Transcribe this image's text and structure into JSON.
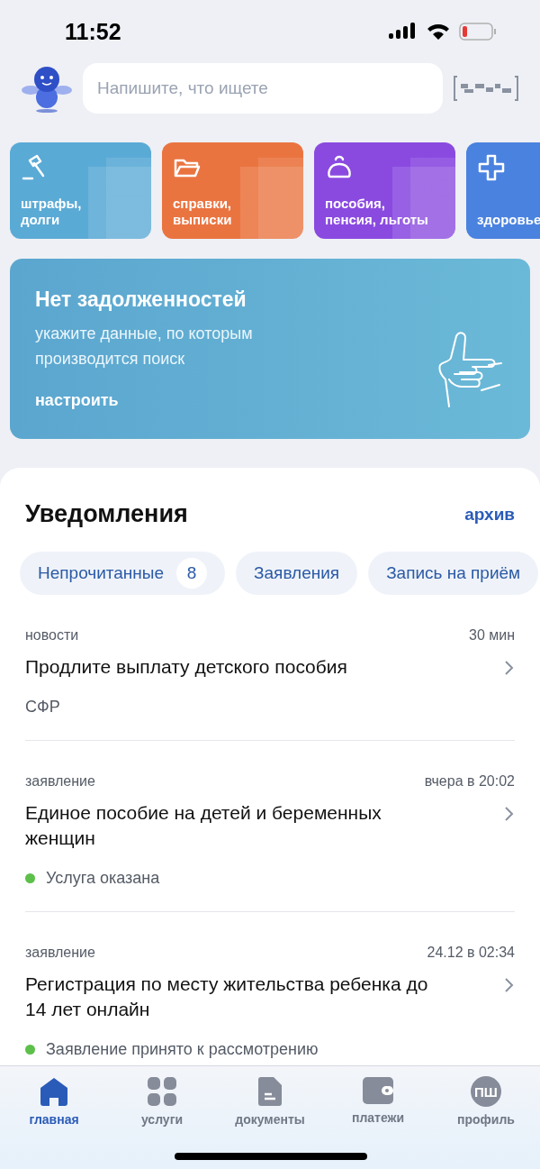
{
  "status_bar": {
    "time": "11:52"
  },
  "search": {
    "placeholder": "Напишите, что ищете"
  },
  "tiles": [
    {
      "kind": "gavel",
      "label": "штрафы,\nдолги",
      "color": "#5aaad6"
    },
    {
      "kind": "folder",
      "label": "справки,\nвыписки",
      "color": "#ea7440"
    },
    {
      "kind": "purse",
      "label": "пособия,\nпенсия, льготы",
      "color": "#8a4ae0"
    },
    {
      "kind": "cross",
      "label": "здоровье",
      "color": "#4a82e0"
    }
  ],
  "banner": {
    "title": "Нет задолженностей",
    "text": "укажите данные, по которым производится поиск",
    "action": "настроить"
  },
  "notifications": {
    "title": "Уведомления",
    "archive": "архив",
    "filters": [
      {
        "label": "Непрочитанные",
        "count": "8"
      },
      {
        "label": "Заявления"
      },
      {
        "label": "Запись на приём"
      }
    ],
    "items": [
      {
        "category": "новости",
        "time": "30 мин",
        "title": "Продлите выплату детского пособия",
        "kind": "source",
        "note": "СФР"
      },
      {
        "category": "заявление",
        "time": "вчера в 20:02",
        "title": "Единое пособие на детей и беременных женщин",
        "kind": "status",
        "note": "Услуга оказана",
        "color": "#5cc04a"
      },
      {
        "category": "заявление",
        "time": "24.12 в 02:34",
        "title": "Регистрация по месту жительства ребенка до 14 лет онлайн",
        "kind": "status",
        "note": "Заявление принято к рассмотрению",
        "color": "#5cc04a"
      }
    ]
  },
  "nav": [
    {
      "kind": "home",
      "label": "главная",
      "selected": true
    },
    {
      "kind": "grid",
      "label": "услуги",
      "selected": false
    },
    {
      "kind": "document",
      "label": "документы",
      "selected": false
    },
    {
      "kind": "wallet",
      "label": "платежи",
      "selected": false
    },
    {
      "kind": "profile",
      "label": "профиль",
      "selected": false,
      "initials": "ПШ"
    }
  ]
}
